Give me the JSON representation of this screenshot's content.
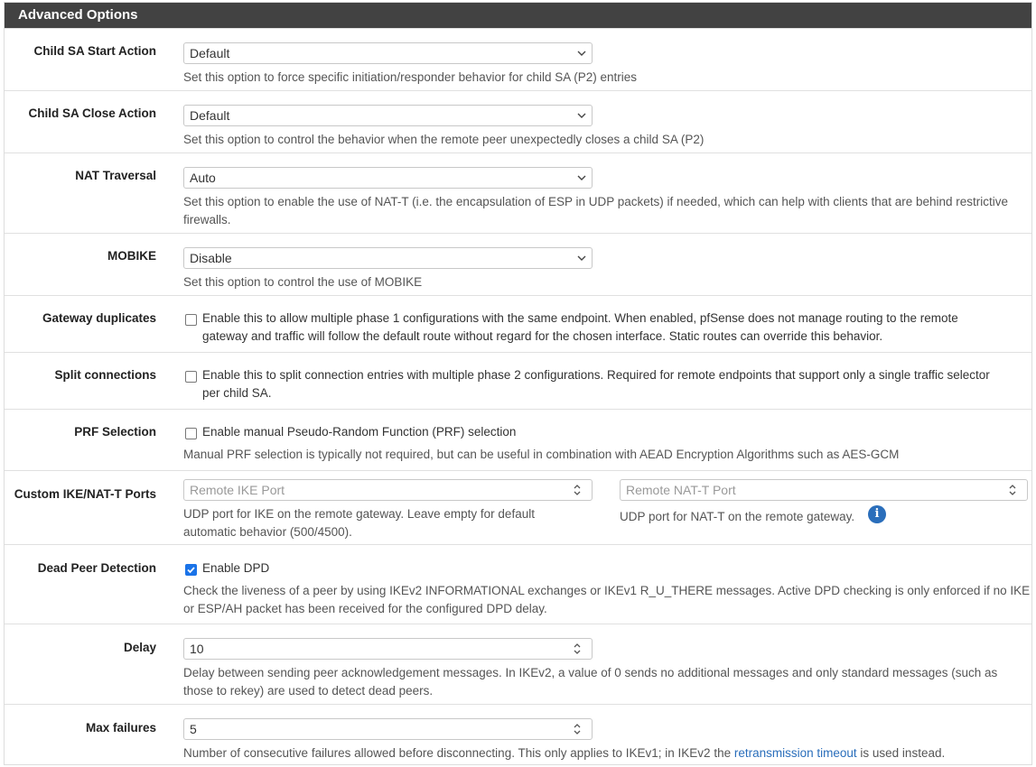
{
  "panel": {
    "title": "Advanced Options"
  },
  "child_sa_start": {
    "label": "Child SA Start Action",
    "value": "Default",
    "help": "Set this option to force specific initiation/responder behavior for child SA (P2) entries"
  },
  "child_sa_close": {
    "label": "Child SA Close Action",
    "value": "Default",
    "help": "Set this option to control the behavior when the remote peer unexpectedly closes a child SA (P2)"
  },
  "nat_traversal": {
    "label": "NAT Traversal",
    "value": "Auto",
    "help_line1": "Set this option to enable the use of NAT-T (i.e. the encapsulation of ESP in UDP packets) if needed, which can help with clients that are behind restrictive",
    "help_line2": "firewalls."
  },
  "mobike": {
    "label": "MOBIKE",
    "value": "Disable",
    "help": "Set this option to control the use of MOBIKE"
  },
  "gateway_duplicates": {
    "label": "Gateway duplicates",
    "checked": false,
    "text_line1": "Enable this to allow multiple phase 1 configurations with the same endpoint. When enabled, pfSense does not manage routing to the remote",
    "text_line2": "gateway and traffic will follow the default route without regard for the chosen interface. Static routes can override this behavior."
  },
  "split_connections": {
    "label": "Split connections",
    "checked": false,
    "text_line1": "Enable this to split connection entries with multiple phase 2 configurations. Required for remote endpoints that support only a single traffic selector",
    "text_line2": "per child SA."
  },
  "prf_selection": {
    "label": "PRF Selection",
    "checked": false,
    "text": "Enable manual Pseudo-Random Function (PRF) selection",
    "help": "Manual PRF selection is typically not required, but can be useful in combination with AEAD Encryption Algorithms such as AES-GCM"
  },
  "custom_ports": {
    "label": "Custom IKE/NAT-T Ports",
    "ike_placeholder": "Remote IKE Port",
    "ike_help_line1": "UDP port for IKE on the remote gateway. Leave empty for default",
    "ike_help_line2": "automatic behavior (500/4500).",
    "natt_placeholder": "Remote NAT-T Port",
    "natt_help": "UDP port for NAT-T on the remote gateway.",
    "info_glyph": "i"
  },
  "dpd": {
    "label": "Dead Peer Detection",
    "checked": true,
    "text": "Enable DPD",
    "help_line1": "Check the liveness of a peer by using IKEv2 INFORMATIONAL exchanges or IKEv1 R_U_THERE messages. Active DPD checking is only enforced if no IKE",
    "help_line2": "or ESP/AH packet has been received for the configured DPD delay."
  },
  "delay": {
    "label": "Delay",
    "value": "10",
    "help_line1": "Delay between sending peer acknowledgement messages. In IKEv2, a value of 0 sends no additional messages and only standard messages (such as",
    "help_line2": "those to rekey) are used to detect dead peers."
  },
  "max_failures": {
    "label": "Max failures",
    "value": "5",
    "help_prefix": "Number of consecutive failures allowed before disconnecting. This only applies to IKEv1; in IKEv2 the ",
    "help_link": "retransmission timeout",
    "help_suffix": " is used instead."
  },
  "colors": {
    "heading_bg": "#424242",
    "link": "#2a6ebb",
    "checkbox_checked": "#1a73e8"
  }
}
